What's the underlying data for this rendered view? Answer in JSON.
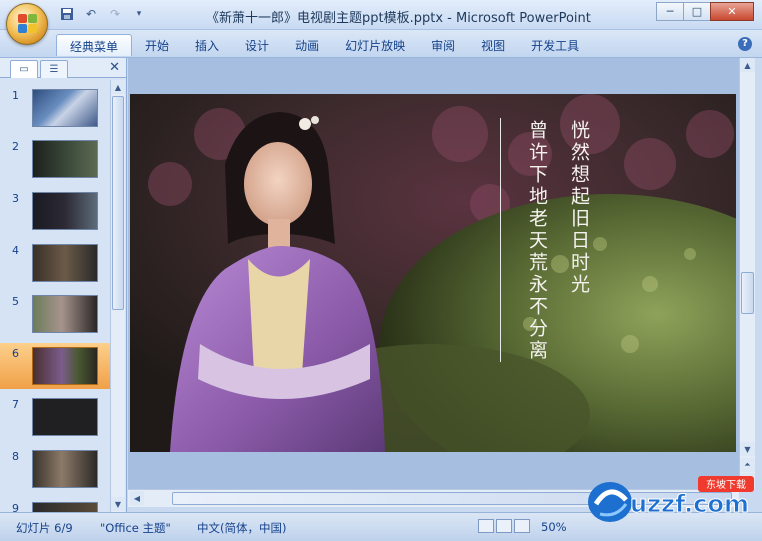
{
  "window": {
    "title": "《新萧十一郎》电视剧主题ppt模板.pptx - Microsoft PowerPoint",
    "controls": [
      "─",
      "□",
      "✕"
    ]
  },
  "qat": {
    "icons": [
      "save-icon",
      "undo-icon",
      "redo-icon",
      "customize-icon"
    ]
  },
  "ribbon": {
    "tabs": [
      "经典菜单",
      "开始",
      "插入",
      "设计",
      "动画",
      "幻灯片放映",
      "审阅",
      "视图",
      "开发工具"
    ],
    "active": "经典菜单",
    "help": "?"
  },
  "panel": {
    "close": "✕",
    "slides": [
      {
        "num": "1"
      },
      {
        "num": "2"
      },
      {
        "num": "3"
      },
      {
        "num": "4"
      },
      {
        "num": "5"
      },
      {
        "num": "6",
        "selected": true
      },
      {
        "num": "7"
      },
      {
        "num": "8"
      },
      {
        "num": "9"
      }
    ]
  },
  "slide": {
    "poem_right": "恍然想起旧日时光",
    "poem_left": "曾许下地老天荒永不分离"
  },
  "status": {
    "slide_info": "幻灯片 6/9",
    "theme": "\"Office 主题\"",
    "language": "中文(简体，中国)",
    "zoom": "50%"
  },
  "watermark": {
    "text": "uzzf.com",
    "badge": "东坡下载"
  },
  "colors": {
    "accent": "#15428b",
    "selected": "#f0a048"
  }
}
